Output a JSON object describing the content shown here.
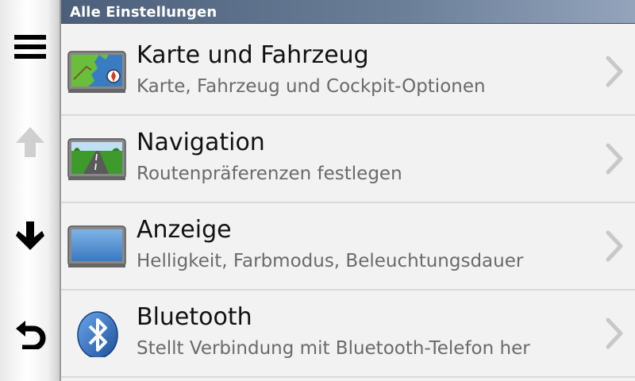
{
  "header": {
    "title": "Alle Einstellungen"
  },
  "rail": [
    {
      "icon": "menu-icon",
      "enabled": true
    },
    {
      "icon": "arrow-up-icon",
      "enabled": false
    },
    {
      "icon": "arrow-down-icon",
      "enabled": true
    },
    {
      "icon": "back-icon",
      "enabled": true
    }
  ],
  "items": [
    {
      "title": "Karte und Fahrzeug",
      "subtitle": "Karte, Fahrzeug und Cockpit-Optionen",
      "icon": "map-icon"
    },
    {
      "title": "Navigation",
      "subtitle": "Routenpräferenzen festlegen",
      "icon": "road-icon"
    },
    {
      "title": "Anzeige",
      "subtitle": "Helligkeit, Farbmodus, Beleuchtungsdauer",
      "icon": "display-icon"
    },
    {
      "title": "Bluetooth",
      "subtitle": "Stellt Verbindung mit Bluetooth-Telefon her",
      "icon": "bluetooth-icon"
    }
  ],
  "colors": {
    "header": "#5c6f8a",
    "background": "#f2f2f2",
    "subtitle": "#6a6a6a"
  }
}
